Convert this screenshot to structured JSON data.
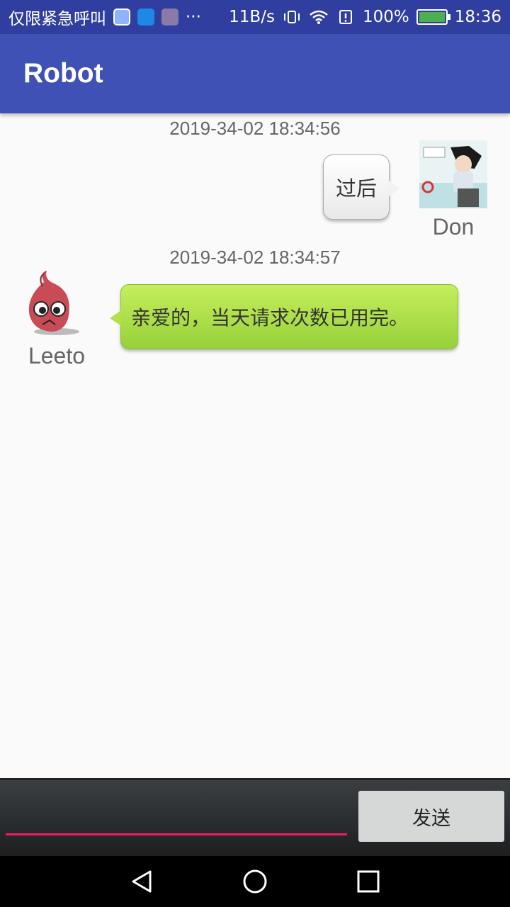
{
  "status_bar": {
    "carrier_text": "仅限紧急呼叫",
    "more": "···",
    "speed": "11B/s",
    "battery": "100%",
    "time": "18:36"
  },
  "app_bar": {
    "title": "Robot"
  },
  "messages": [
    {
      "timestamp": "2019-34-02 18:34:56",
      "sender": "Don",
      "text": "过后",
      "side": "right"
    },
    {
      "timestamp": "2019-34-02 18:34:57",
      "sender": "Leeto",
      "text": "亲爱的，当天请求次数已用完。",
      "side": "left"
    }
  ],
  "input": {
    "value": "",
    "send_label": "发送"
  },
  "colors": {
    "status_bar": "#303f9f",
    "app_bar": "#3f51b5",
    "accent": "#e91e63",
    "bot_bubble": "#b4e04c"
  }
}
